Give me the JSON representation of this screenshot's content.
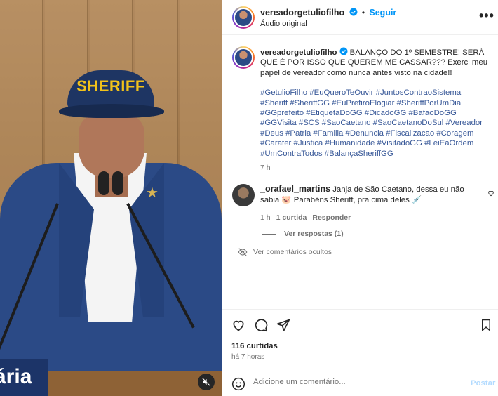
{
  "header": {
    "username": "vereadorgetuliofilho",
    "separator": "•",
    "follow_label": "Seguir",
    "audio_label": "Áudio original",
    "more_icon": "more-horizontal-icon"
  },
  "video": {
    "cap_text": "SHERIFF",
    "lower_third_text": "ária",
    "mute_icon": "muted-speaker-icon"
  },
  "caption": {
    "username": "vereadorgetuliofilho",
    "text": "BALANÇO DO 1º SEMESTRE! SERÁ QUE É POR ISSO QUE QUEREM ME CASSAR??? Exerci meu papel de vereador como nunca antes visto na cidade!!",
    "hashtags": "#GetulioFilho #EuQueroTeOuvir #JuntosContraoSistema #Sheriff #SheriffGG #EuPrefiroElogiar #SheriffPorUmDia #GGprefeito #EtiquetaDoGG #DicadoGG #BafaoDoGG #GGVisita #SCS #SaoCaetano #SaoCaetanoDoSul #Vereador #Deus #Patria #Familia #Denuncia #Fiscalizacao #Coragem #Carater #Justica #Humanidade #VisitadoGG #LeiEaOrdem #UmContraTodos #BalançaSheriffGG",
    "time": "7 h"
  },
  "comment": {
    "username": "_orafael_martins",
    "text": "Janja de São Caetano, dessa eu não sabia 🐷 Parabéns Sheriff, pra cima deles 💉",
    "time": "1 h",
    "likes": "1 curtida",
    "reply_label": "Responder",
    "view_replies": "Ver respostas (1)",
    "hidden_comments": "Ver comentários ocultos"
  },
  "actions": {
    "likes": "116 curtidas",
    "posted_ago": "há 7 horas"
  },
  "composer": {
    "placeholder": "Adicione um comentário...",
    "post_label": "Postar"
  },
  "colors": {
    "link_blue": "#0095f6",
    "hashtag_blue": "#385898",
    "muted_text": "#737373",
    "border": "#efefef"
  }
}
